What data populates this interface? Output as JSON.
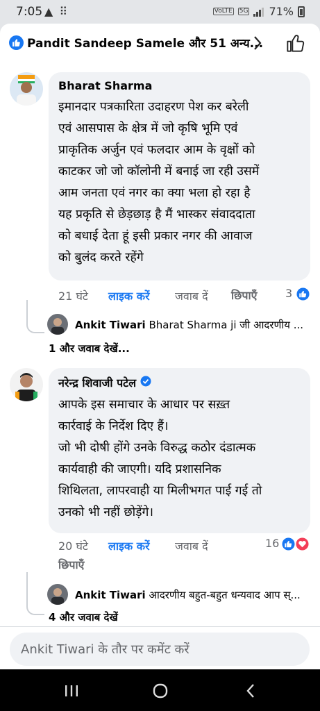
{
  "status_bar": {
    "time": "7:05",
    "left_icons": "▲ ⠿",
    "lte": "VoLTE",
    "network": "5G",
    "battery": "71%"
  },
  "header": {
    "reactors": "Pandit Sandeep Samele और 51 अन्य..."
  },
  "comments": [
    {
      "author": "Bharat Sharma",
      "lines": [
        "इमानदार पत्रकारिता उदाहरण पेश कर बरेली",
        "एवं आसपास के क्षेत्र में जो कृषि भूमि एवं",
        "प्राकृतिक अर्जुन एवं फलदार आम के वृक्षों को",
        "काटकर जो जो कॉलोनी में बनाई जा रही उसमें",
        "आम जनता एवं नगर का क्या भला हो रहा है",
        "यह प्रकृति से छेड़छाड़ है मैं भास्कर संवाददाता",
        "को बधाई देता हूं इसी प्रकार नगर की आवाज",
        "को बुलंद करते रहेंगे"
      ],
      "time": "21 घंटे",
      "like": "लाइक करें",
      "reply": "जवाब दें",
      "hide": "छिपाएँ",
      "reaction_count": "3",
      "reply_preview": {
        "author": "Ankit Tiwari",
        "text": "Bharat Sharma ji जी आदरणीय ..."
      },
      "more_replies": "1 और जवाब देखें..."
    },
    {
      "author": "नरेन्द्र शिवाजी पटेल",
      "verified": true,
      "lines": [
        "आपके इस समाचार के आधार पर सख़्त",
        "कार्रवाई के निर्देश दिए हैं।",
        "जो भी दोषी होंगे उनके विरुद्ध कठोर दंडात्मक",
        "कार्यवाही की जाएगी। यदि प्रशासनिक",
        "शिथिलता, लापरवाही या मिलीभगत पाई गई तो",
        "उनको भी नहीं छोड़ेंगे।"
      ],
      "time": "20 घंटे",
      "like": "लाइक करें",
      "reply": "जवाब दें",
      "hide": "छिपाएँ",
      "reaction_count": "16",
      "reply_preview": {
        "author": "Ankit Tiwari",
        "text": "आदरणीय बहुत-बहुत धन्यवाद आप स्..."
      },
      "more_replies": "4 और जवाब देखें"
    }
  ],
  "composer": {
    "placeholder": "Ankit Tiwari के तौर पर कमेंट करें"
  },
  "colors": {
    "accent": "#1877f2",
    "bubble": "#f0f2f5",
    "love": "#f33e58"
  }
}
